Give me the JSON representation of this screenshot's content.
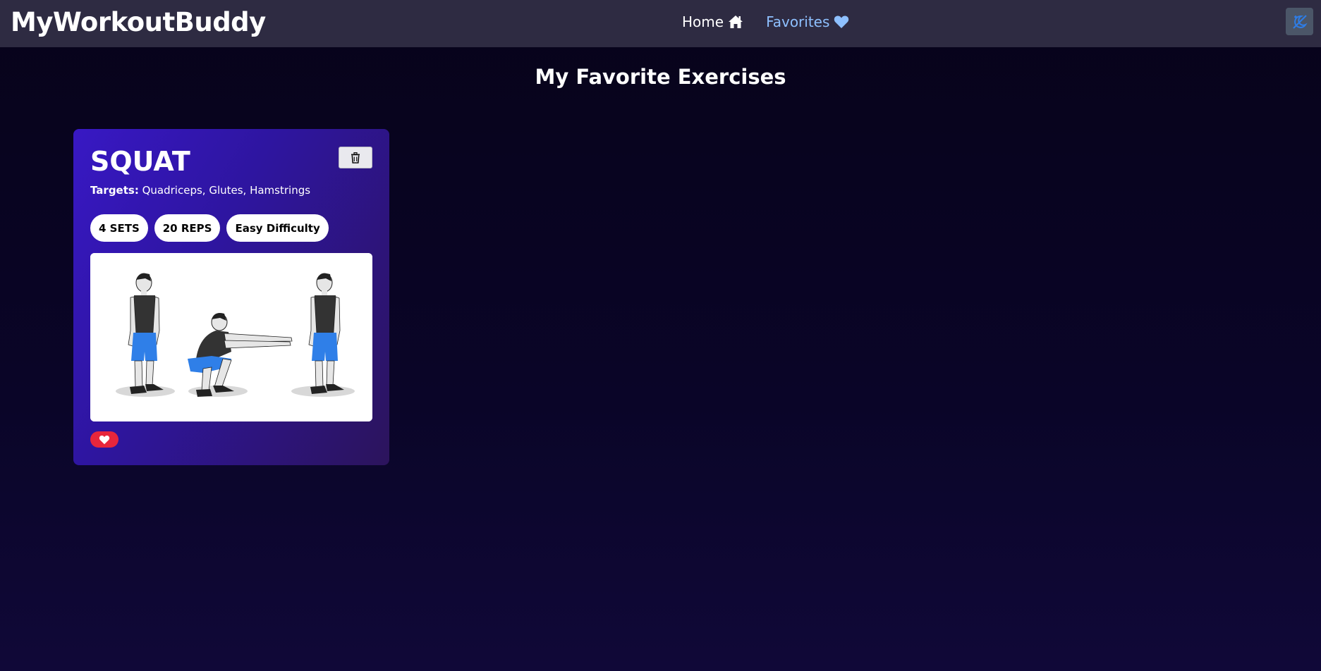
{
  "navbar": {
    "brand": "MyWorkoutBuddy",
    "links": [
      {
        "label": "Home",
        "icon": "home-icon"
      },
      {
        "label": "Favorites",
        "icon": "heart-icon"
      }
    ],
    "theme_toggle_icon": "moon-icon"
  },
  "page": {
    "title": "My Favorite Exercises"
  },
  "favorites": [
    {
      "name": "SQUAT",
      "targets_label": "Targets:",
      "targets": "Quadriceps, Glutes, Hamstrings",
      "sets": "4 SETS",
      "reps": "20 REPS",
      "difficulty": "Easy Difficulty",
      "image_alt": "squat-illustration",
      "favorited": true
    }
  ],
  "colors": {
    "navbar_bg": "#2e2b42",
    "favorites_link": "#8ec0ff",
    "card_gradient_start": "#3818c4",
    "card_gradient_end": "#2c145c",
    "favorite_button": "#e7263c",
    "theme_toggle_bg": "#4b5668"
  }
}
